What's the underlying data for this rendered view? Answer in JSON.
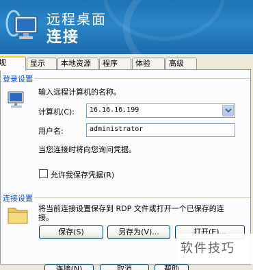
{
  "banner": {
    "title_line1": "远程桌面",
    "title_line2": "连接",
    "colors": {
      "background": "#1d73b3",
      "text": "#ffffff"
    }
  },
  "tabs": [
    {
      "label": "常规",
      "visible_label": "常规",
      "active": true
    },
    {
      "label": "显示"
    },
    {
      "label": "本地资源"
    },
    {
      "label": "程序"
    },
    {
      "label": "体验"
    },
    {
      "label": "高级"
    }
  ],
  "login_group": {
    "title": "登录设置",
    "instruction": "输入远程计算机的名称。",
    "computer_label": "计算机(C):",
    "computer_value": "16.16.16.199",
    "username_label": "用户名:",
    "username_value": "administrator",
    "credential_note": "当您连接时将向您询问凭据。",
    "save_credentials_label": "允许我保存凭据(R)",
    "save_credentials_checked": false
  },
  "connection_group": {
    "title": "连接设置",
    "description_line1": "将当前连接设置保存到 RDP 文件或打开一个已保存的连",
    "description_line2": "接。",
    "save_button": "保存(S)",
    "save_as_button": "另存为(V)...",
    "open_button": "打开(E)..."
  },
  "footer_buttons": {
    "connect": "连接(N)",
    "cancel": "取消",
    "help": "帮助"
  },
  "watermark": "软件技巧",
  "icons": [
    "remote-desktop-logo-icon",
    "monitor-icon",
    "chevron-down-icon",
    "folder-icon"
  ]
}
